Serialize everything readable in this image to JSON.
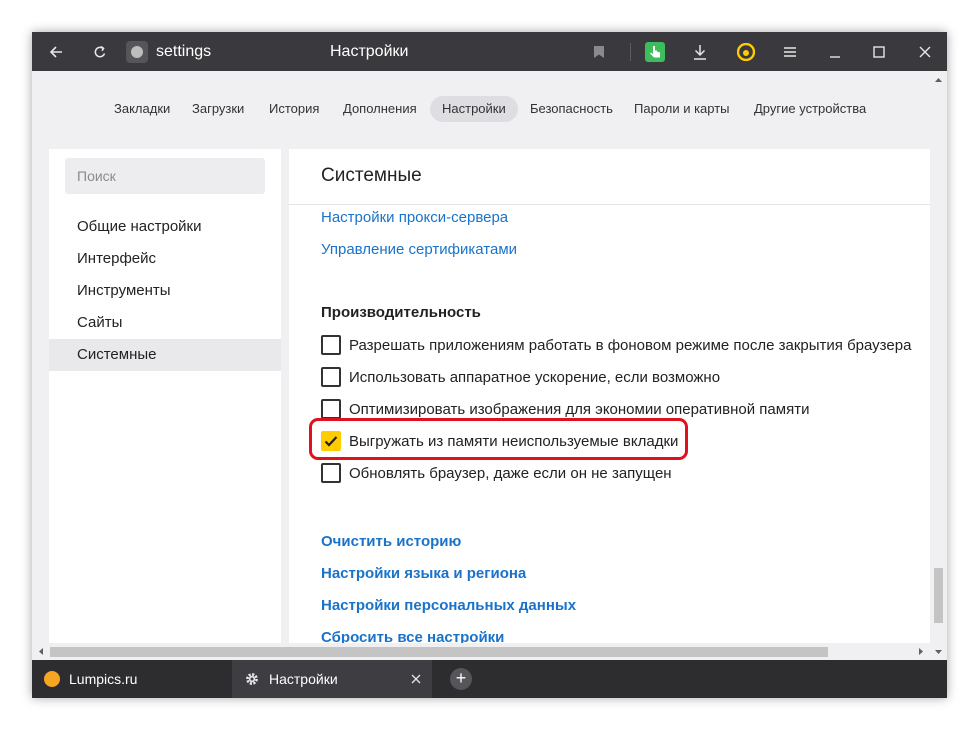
{
  "titlebar": {
    "address": "settings",
    "window_title": "Настройки"
  },
  "nav_tabs": [
    {
      "label": "Закладки"
    },
    {
      "label": "Загрузки"
    },
    {
      "label": "История"
    },
    {
      "label": "Дополнения"
    },
    {
      "label": "Настройки",
      "active": true
    },
    {
      "label": "Безопасность"
    },
    {
      "label": "Пароли и карты"
    },
    {
      "label": "Другие устройства"
    }
  ],
  "sidebar": {
    "search_placeholder": "Поиск",
    "items": [
      {
        "label": "Общие настройки"
      },
      {
        "label": "Интерфейс"
      },
      {
        "label": "Инструменты"
      },
      {
        "label": "Сайты"
      },
      {
        "label": "Системные",
        "active": true
      }
    ]
  },
  "main": {
    "title": "Системные",
    "links": [
      "Настройки прокси-сервера",
      "Управление сертификатами"
    ],
    "performance": {
      "heading": "Производительность",
      "options": [
        {
          "label": "Разрешать приложениям работать в фоновом режиме после закрытия браузера",
          "checked": false
        },
        {
          "label": "Использовать аппаратное ускорение, если возможно",
          "checked": false
        },
        {
          "label": "Оптимизировать изображения для экономии оперативной памяти",
          "checked": false
        },
        {
          "label": "Выгружать из памяти неиспользуемые вкладки",
          "checked": true
        },
        {
          "label": "Обновлять браузер, даже если он не запущен",
          "checked": false
        }
      ]
    },
    "bottom_links": [
      "Очистить историю",
      "Настройки языка и региона",
      "Настройки персональных данных",
      "Сбросить все настройки"
    ]
  },
  "tabs": [
    {
      "label": "Lumpics.ru",
      "icon": "orange-circle-favicon"
    },
    {
      "label": "Настройки",
      "icon": "gear-icon",
      "active": true
    }
  ],
  "new_tab_label": "+",
  "colors": {
    "accent_link": "#1a73c9",
    "checkbox_checked": "#ffcc00",
    "highlight": "#e0101e"
  }
}
